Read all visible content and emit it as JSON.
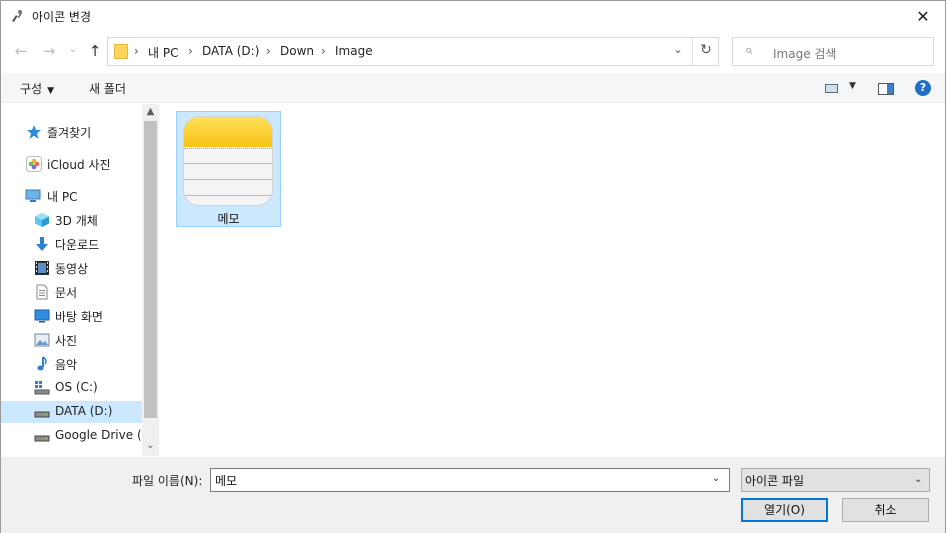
{
  "window": {
    "title": "아이콘 변경",
    "close_glyph": "✕"
  },
  "nav": {
    "back_glyph": "←",
    "forward_glyph": "→",
    "recent_glyph": "⌄",
    "up_glyph": "↑",
    "breadcrumb": [
      "내 PC",
      "DATA (D:)",
      "Down",
      "Image"
    ],
    "breadcrumb_sep": "›",
    "dropdown_glyph": "⌄",
    "refresh_glyph": "↻",
    "search_placeholder": "Image 검색",
    "search_glyph": "⌕"
  },
  "toolbar": {
    "organize_label": "구성",
    "organize_caret": "▼",
    "new_folder_label": "새 폴더",
    "view_caret": "▼",
    "help_label": "?"
  },
  "sidebar": {
    "items": [
      {
        "label": "즐겨찾기",
        "icon": "star-icon"
      },
      {
        "label": "iCloud 사진",
        "icon": "icloud-photos-icon"
      },
      {
        "label": "내 PC",
        "icon": "computer-icon"
      },
      {
        "label": "3D 개체",
        "icon": "cube-3d-icon"
      },
      {
        "label": "다운로드",
        "icon": "download-icon"
      },
      {
        "label": "동영상",
        "icon": "video-icon"
      },
      {
        "label": "문서",
        "icon": "document-icon"
      },
      {
        "label": "바탕 화면",
        "icon": "desktop-icon"
      },
      {
        "label": "사진",
        "icon": "pictures-icon"
      },
      {
        "label": "음악",
        "icon": "music-icon"
      },
      {
        "label": "OS (C:)",
        "icon": "drive-os-icon"
      },
      {
        "label": "DATA (D:)",
        "icon": "drive-icon",
        "selected": true
      },
      {
        "label": "Google Drive (Z",
        "icon": "drive-icon"
      }
    ],
    "scroll_up_glyph": "▲",
    "scroll_down_glyph": "⌄"
  },
  "files": [
    {
      "name": "메모",
      "icon": "memo-app-icon",
      "selected": true
    }
  ],
  "footer": {
    "filename_label": "파일 이름(N):",
    "filename_value": "메모",
    "filename_caret": "⌄",
    "filetype_value": "아이콘 파일",
    "filetype_caret": "⌄",
    "open_label": "열기(O)",
    "cancel_label": "취소"
  },
  "colors": {
    "selection": "#cce8ff",
    "selection_border": "#99d1ff",
    "primary_border": "#0078d7",
    "memo_yellow": "#f7c315"
  }
}
